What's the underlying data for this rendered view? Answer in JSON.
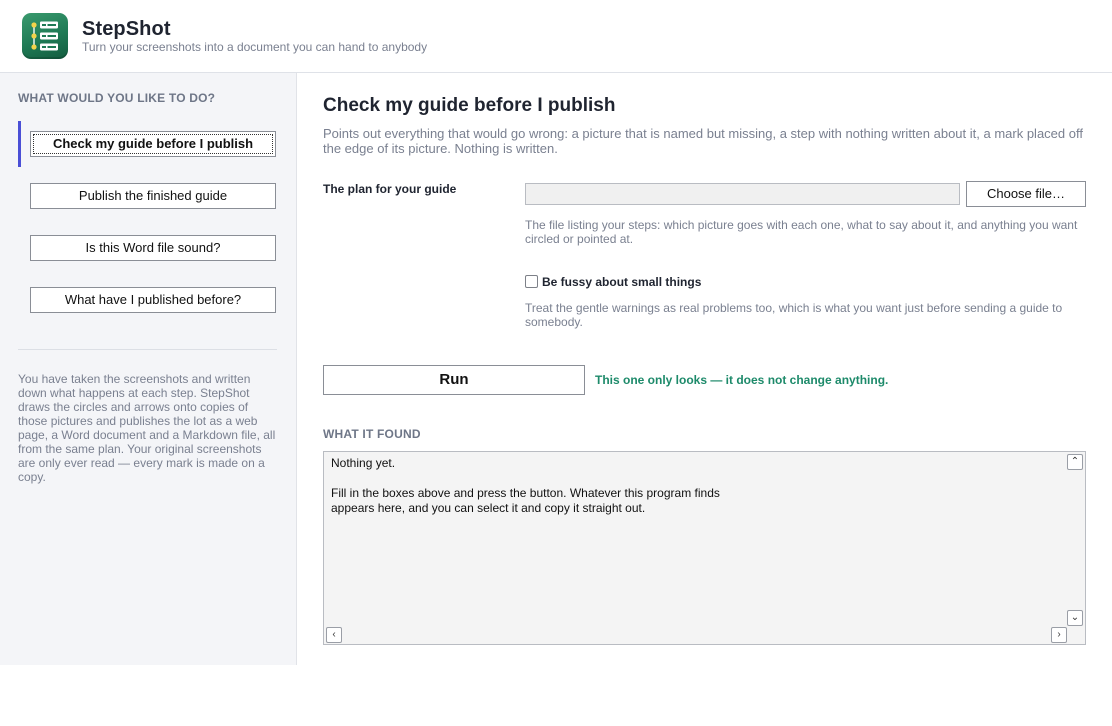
{
  "app": {
    "title": "StepShot",
    "subtitle": "Turn your screenshots into a document you can hand to anybody",
    "logo_icon": "checklist-icon",
    "brand_color": "#2a8a60"
  },
  "sidebar": {
    "heading": "WHAT WOULD YOU LIKE TO DO?",
    "items": [
      {
        "label": "Check my guide before I publish",
        "active": true
      },
      {
        "label": "Publish the finished guide",
        "active": false
      },
      {
        "label": "Is this Word file sound?",
        "active": false
      },
      {
        "label": "What have I published before?",
        "active": false
      }
    ],
    "active_color": "#4a4fd6",
    "note": "You have taken the screenshots and written down what happens at each step. StepShot draws the circles and arrows onto copies of those pictures and publishes the lot as a web page, a Word document and a Markdown file, all from the same plan. Your original screenshots are only ever read — every mark is made on a copy."
  },
  "main": {
    "title": "Check my guide before I publish",
    "description": "Points out everything that would go wrong: a picture that is named but missing, a step with nothing written about it, a mark placed off the edge of its picture. Nothing is written.",
    "plan_field": {
      "label": "The plan for your guide",
      "value": "",
      "button_label": "Choose file…",
      "help": "The file listing your steps: which picture goes with each one, what to say about it, and anything you want circled or pointed at."
    },
    "fussy_option": {
      "label": "Be fussy about small things",
      "checked": false,
      "help": "Treat the gentle warnings as real problems too, which is what you want just before sending a guide to somebody."
    },
    "run": {
      "label": "Run",
      "note": "This one only looks — it does not change anything.",
      "note_color": "#1d8a6a"
    },
    "results": {
      "heading": "WHAT IT FOUND",
      "text": "Nothing yet.\n\nFill in the boxes above and press the button. Whatever this program finds\nappears here, and you can select it and copy it straight out."
    }
  }
}
